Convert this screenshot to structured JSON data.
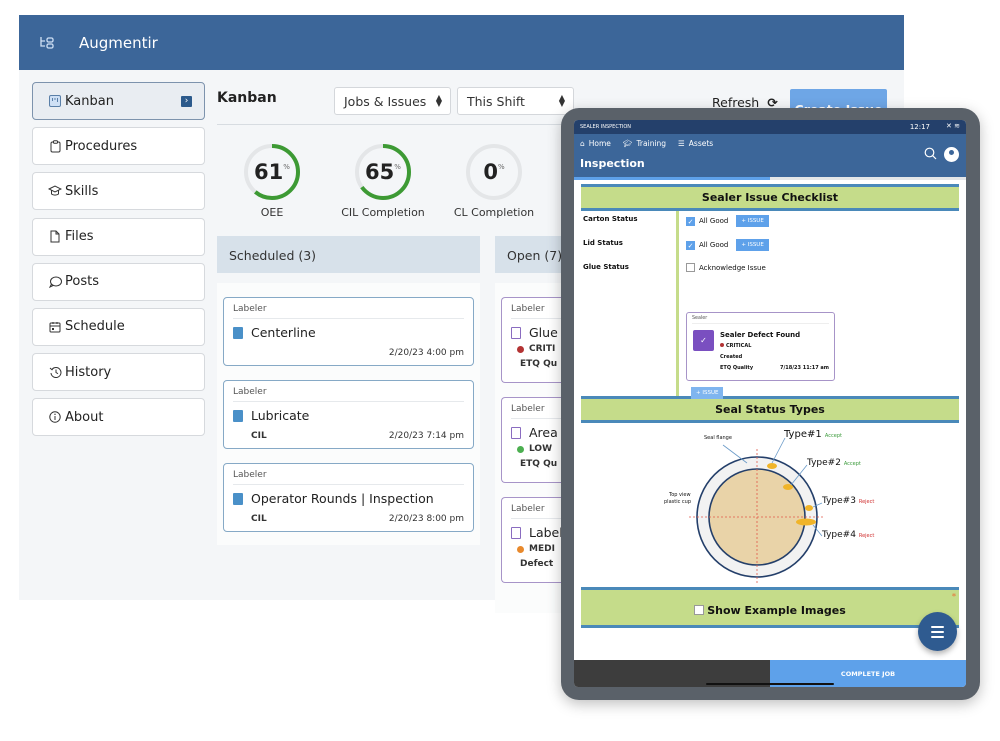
{
  "app": {
    "brand": "Augmentir",
    "logo_icon": "workflow-logo-icon"
  },
  "sidebar": {
    "items": [
      {
        "label": "Kanban",
        "icon": "kanban-board-icon",
        "active": true
      },
      {
        "label": "Procedures",
        "icon": "clipboard-icon",
        "active": false
      },
      {
        "label": "Skills",
        "icon": "graduation-cap-icon",
        "active": false
      },
      {
        "label": "Files",
        "icon": "file-icon",
        "active": false
      },
      {
        "label": "Posts",
        "icon": "speech-bubble-icon",
        "active": false
      },
      {
        "label": "Schedule",
        "icon": "calendar-icon",
        "active": false
      },
      {
        "label": "History",
        "icon": "history-icon",
        "active": false
      },
      {
        "label": "About",
        "icon": "info-icon",
        "active": false
      }
    ]
  },
  "main": {
    "title": "Kanban",
    "filter_type": "Jobs & Issues",
    "filter_period": "This Shift",
    "refresh_label": "Refresh",
    "create_issue_label": "Create Issue",
    "gauges": [
      {
        "value": "61",
        "unit": "%",
        "label": "OEE",
        "percent": 61,
        "color": "#3d9a34"
      },
      {
        "value": "65",
        "unit": "%",
        "label": "CIL Completion",
        "percent": 65,
        "color": "#3d9a34"
      },
      {
        "value": "0",
        "unit": "%",
        "label": "CL Completion",
        "percent": 0,
        "color": "#3d9a34"
      }
    ],
    "columns": [
      {
        "title": "Scheduled (3)",
        "cards": [
          {
            "site": "Labeler",
            "title": "Centerline",
            "sub": "",
            "time": "2/20/23 4:00 pm"
          },
          {
            "site": "Labeler",
            "title": "Lubricate",
            "sub": "CIL",
            "time": "2/20/23 7:14 pm"
          },
          {
            "site": "Labeler",
            "title": "Operator Rounds | Inspection",
            "sub": "CIL",
            "time": "2/20/23 8:00 pm"
          }
        ]
      },
      {
        "title": "Open (7)",
        "cards": [
          {
            "site": "Labeler",
            "title": "Glue i",
            "priority": "CRITI",
            "priority_color": "#b33333",
            "source": "ETQ Qu"
          },
          {
            "site": "Labeler",
            "title": "Area a",
            "priority": "LOW",
            "priority_color": "#4caf50",
            "source": "ETQ Qu"
          },
          {
            "site": "Labeler",
            "title": "Label",
            "priority": "MEDI",
            "priority_color": "#e8892c",
            "source": "Defect"
          }
        ]
      }
    ]
  },
  "tablet": {
    "status_title": "SEALER INSPECTION",
    "status_time": "12:17",
    "nav": [
      {
        "label": "Home",
        "icon": "home-icon"
      },
      {
        "label": "Training",
        "icon": "graduation-cap-icon"
      },
      {
        "label": "Assets",
        "icon": "assets-icon"
      }
    ],
    "page_title": "Inspection",
    "progress_percent": 50,
    "checklist": {
      "title": "Sealer Issue Checklist",
      "rows": [
        {
          "label": "Carton Status",
          "option": "All Good",
          "checked": true,
          "issue_label": "+ ISSUE"
        },
        {
          "label": "Lid Status",
          "option": "All Good",
          "checked": true,
          "issue_label": "+ ISSUE"
        },
        {
          "label": "Glue Status",
          "option": "Acknowledge Issue",
          "checked": false
        }
      ],
      "defect_card": {
        "site": "Sealer",
        "title": "Sealer Defect Found",
        "priority": "CRITICAL",
        "status": "Created",
        "source": "ETQ Quality",
        "time": "7/18/23 11:17 am"
      },
      "add_issue_label": "+ ISSUE"
    },
    "seal_types": {
      "title": "Seal Status Types",
      "labels": {
        "seal_flange": "Seal flange",
        "top_view_1": "Top view",
        "top_view_2": "plastic cup"
      },
      "types": [
        {
          "name": "Type#1",
          "status": "Accept",
          "status_color": "#3a9a3a"
        },
        {
          "name": "Type#2",
          "status": "Accept",
          "status_color": "#3a9a3a"
        },
        {
          "name": "Type#3",
          "status": "Reject",
          "status_color": "#d03030"
        },
        {
          "name": "Type#4",
          "status": "Reject",
          "status_color": "#d03030"
        }
      ]
    },
    "show_examples_label": "Show Example Images",
    "complete_job_label": "COMPLETE JOB"
  }
}
